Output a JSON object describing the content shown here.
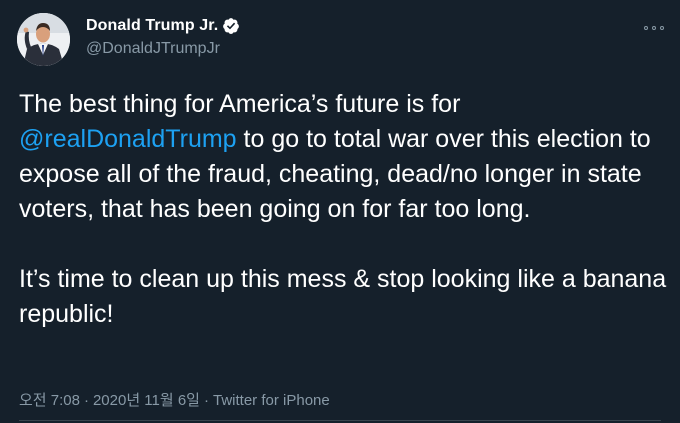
{
  "user": {
    "display_name": "Donald Trump Jr.",
    "handle": "@DonaldJTrumpJr",
    "verified": true,
    "avatar_icon": "profile-photo"
  },
  "more_icon": "more-options-icon",
  "tweet": {
    "text_part1": "The best thing for America’s future is for ",
    "mention": "@realDonaldTrump",
    "text_part2": " to go to total war over this election to expose all of the fraud, cheating, dead/no longer in state voters, that has been going on for far too long.\n\nIt’s time to clean up this mess & stop looking like a banana republic!"
  },
  "meta": {
    "time": "오전 7:08",
    "separator": "·",
    "date": "2020년 11월 6일",
    "source": "Twitter for iPhone"
  },
  "colors": {
    "background": "#15202b",
    "text": "#ffffff",
    "secondary": "#8899a6",
    "link": "#1da1f2"
  }
}
